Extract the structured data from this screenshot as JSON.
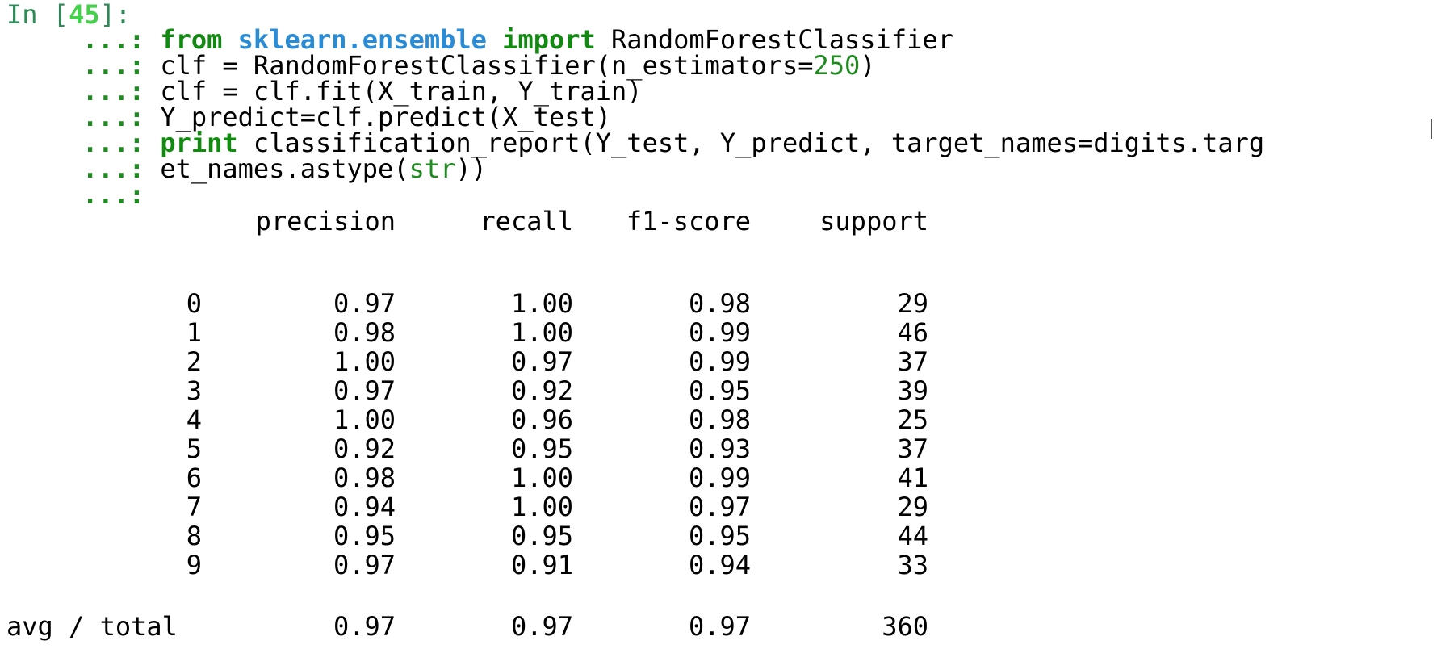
{
  "prompt": {
    "label": "In [",
    "number": "45",
    "close": "]:"
  },
  "continuation": "...:",
  "code": {
    "line1": {
      "kw1": "from",
      "module": "sklearn.ensemble",
      "kw2": "import",
      "name": "RandomForestClassifier"
    },
    "line2": {
      "pre": "clf = RandomForestClassifier(n_estimators=",
      "num": "250",
      "post": ")"
    },
    "line3": {
      "text": "clf = clf.fit(X_train, Y_train)"
    },
    "line4": {
      "text": "Y_predict=clf.predict(X_test)"
    },
    "line5": {
      "kw": "print",
      "text": " classification_report(Y_test, Y_predict, target_names=digits.targ"
    },
    "line6": {
      "pre": "et_names.astype(",
      "builtin": "str",
      "post": "))"
    }
  },
  "report": {
    "headers": [
      "precision",
      "recall",
      "f1-score",
      "support"
    ],
    "rows": [
      {
        "label": "0",
        "precision": "0.97",
        "recall": "1.00",
        "f1": "0.98",
        "support": "29"
      },
      {
        "label": "1",
        "precision": "0.98",
        "recall": "1.00",
        "f1": "0.99",
        "support": "46"
      },
      {
        "label": "2",
        "precision": "1.00",
        "recall": "0.97",
        "f1": "0.99",
        "support": "37"
      },
      {
        "label": "3",
        "precision": "0.97",
        "recall": "0.92",
        "f1": "0.95",
        "support": "39"
      },
      {
        "label": "4",
        "precision": "1.00",
        "recall": "0.96",
        "f1": "0.98",
        "support": "25"
      },
      {
        "label": "5",
        "precision": "0.92",
        "recall": "0.95",
        "f1": "0.93",
        "support": "37"
      },
      {
        "label": "6",
        "precision": "0.98",
        "recall": "1.00",
        "f1": "0.99",
        "support": "41"
      },
      {
        "label": "7",
        "precision": "0.94",
        "recall": "1.00",
        "f1": "0.97",
        "support": "29"
      },
      {
        "label": "8",
        "precision": "0.95",
        "recall": "0.95",
        "f1": "0.95",
        "support": "44"
      },
      {
        "label": "9",
        "precision": "0.97",
        "recall": "0.91",
        "f1": "0.94",
        "support": "33"
      }
    ],
    "total": {
      "label": "avg / total",
      "precision": "0.97",
      "recall": "0.97",
      "f1": "0.97",
      "support": "360"
    }
  },
  "colors": {
    "prompt_number": "#44d04a",
    "keyword": "#128a12",
    "module": "#2b8cd6",
    "number_literal": "#1f8a1f"
  }
}
